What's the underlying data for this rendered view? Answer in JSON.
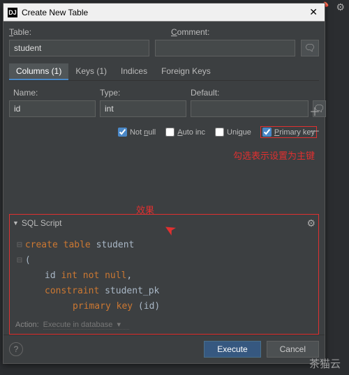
{
  "window": {
    "title": "Create New Table",
    "app_icon_text": "DJ"
  },
  "labels": {
    "table": "Table:",
    "comment": "Comment:",
    "name": "Name:",
    "type": "Type:",
    "default": "Default:"
  },
  "inputs": {
    "table_name": "student",
    "comment": "",
    "col_name": "id",
    "col_type": "int",
    "col_default": ""
  },
  "tabs": {
    "columns": "Columns (1)",
    "keys": "Keys (1)",
    "indices": "Indices",
    "foreign_keys": "Foreign Keys"
  },
  "checks": {
    "not_null": "Not null",
    "auto_inc": "Auto inc",
    "unique": "Unique",
    "primary_key": "Primary key"
  },
  "annotations": {
    "primary_key_note": "勾选表示设置为主键",
    "effect": "效果"
  },
  "script": {
    "header": "SQL Script",
    "code": {
      "l1_kw1": "create",
      "l1_kw2": "table",
      "l1_ident": "student",
      "l2": "(",
      "l3_ident": "id",
      "l3_type": "int",
      "l3_kw": "not null",
      "l3_end": ",",
      "l4_kw": "constraint",
      "l4_ident": "student_pk",
      "l5_kw": "primary key",
      "l5_paren": "(id)"
    },
    "action_label": "Action:",
    "action_value": "Execute in database"
  },
  "footer": {
    "execute": "Execute",
    "cancel": "Cancel"
  },
  "watermark": "茶猫云"
}
